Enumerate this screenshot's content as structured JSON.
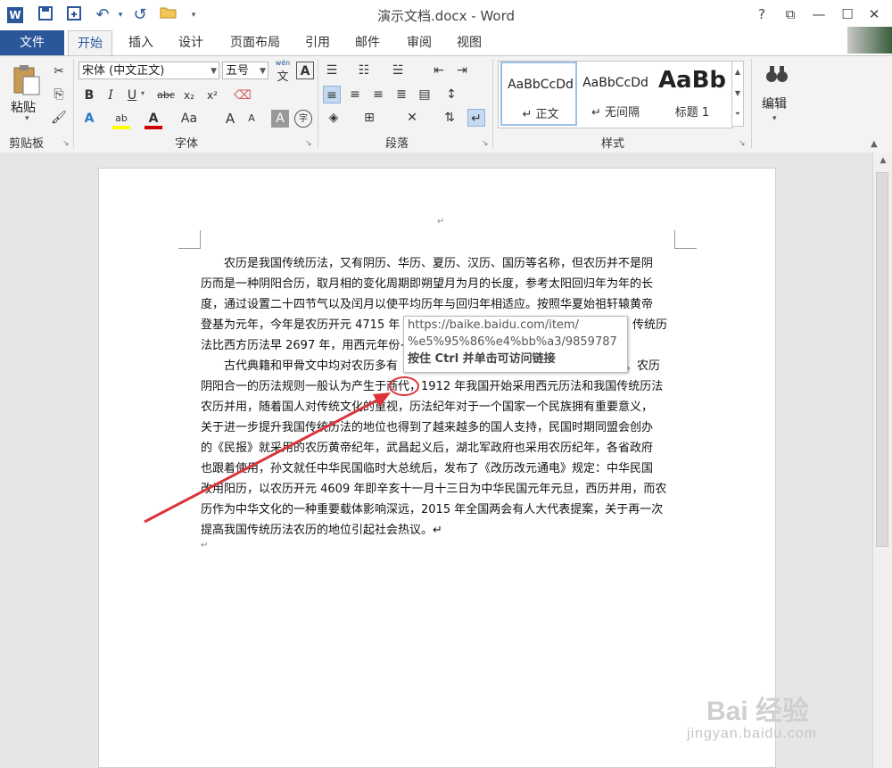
{
  "window": {
    "title": "演示文档.docx - Word",
    "help": "?",
    "restore_ribbon": "⧉",
    "minimize": "—",
    "maximize": "☐",
    "close": "✕"
  },
  "qat": {
    "word_icon": "W",
    "save": "💾",
    "undo": "↶",
    "redo": "↺",
    "open": "📂",
    "more": "▾"
  },
  "tabs": [
    "文件",
    "开始",
    "插入",
    "设计",
    "页面布局",
    "引用",
    "邮件",
    "审阅",
    "视图"
  ],
  "ribbon": {
    "clipboard": {
      "paste_label": "粘贴",
      "group_label": "剪贴板"
    },
    "font": {
      "font_name": "宋体 (中文正文)",
      "font_size": "五号",
      "phonetic": "wén",
      "phonetic_char": "文",
      "char_border": "A",
      "bold": "B",
      "italic": "I",
      "underline": "U",
      "strike": "abc",
      "subscript": "x₂",
      "superscript": "x²",
      "text_effects": "A",
      "highlight": "ab",
      "font_color": "A",
      "change_case": "Aa",
      "grow": "A",
      "shrink": "A",
      "shading": "A",
      "enclose": "字",
      "group_label": "字体",
      "highlight_color": "#ffff00",
      "font_color_value": "#d00000"
    },
    "paragraph": {
      "group_label": "段落"
    },
    "styles": {
      "items": [
        {
          "preview": "AaBbCcDd",
          "name": "↵ 正文"
        },
        {
          "preview": "AaBbCcDd",
          "name": "↵ 无间隔"
        },
        {
          "preview": "AaBb",
          "name": "标题 1"
        }
      ],
      "group_label": "样式"
    },
    "editing": {
      "label": "编辑",
      "icon": "binoculars-icon"
    }
  },
  "document": {
    "top_mark": "↵",
    "para1_lines": [
      "　　农历是我国传统历法，又有阴历、华历、夏历、汉历、国历等名称，但农历并不是阴",
      "历而是一种阴阳合历，取月相的变化周期即朔望月为月的长度，参考太阳回归年为年的长",
      "度，通过设置二十四节气以及闰月以使平均历年与回归年相适应。按照华夏始祖轩辕黄帝",
      "登基为元年，今年是农历开元 4715 年",
      "法比西方历法早 2697 年，用西元年份+"
    ],
    "para1_line4_tail": "传统历",
    "para2_lines": [
      "　　古代典籍和甲骨文中均对农历多有",
      "阴阳合一的历法规则一般认为产生于",
      "农历并用，随着国人对传统文化的重视，历法纪年对于一个国家一个民族拥有重要意义，",
      "关于进一步提升我国传统历法的地位也得到了越来越多的国人支持，民国时期同盟会创办",
      "的《民报》就采用的农历黄帝纪年，武昌起义后，湖北军政府也采用农历纪年，各省政府",
      "也跟着使用，孙文就任中华民国临时大总统后，发布了《改历改元通电》规定：中华民国",
      "改用阳历，以农历开元 4609 年即辛亥十一月十三日为中华民国元年元旦，西历并用，而农",
      "历作为中华文化的一种重要载体影响深远，2015 年全国两会有人大代表提案，关于再一次",
      "提高我国传统历法农历的地位引起社会热议。↵"
    ],
    "para2_line1_tail": "。农历",
    "hyperlink_text": "商代",
    "para2_line2_tail": "，1912 年我国开始采用西元历法和我国传统历法",
    "empty_mark": "↵"
  },
  "tooltip": {
    "url_line1": "https://baike.baidu.com/item/",
    "url_line2": "%e5%95%86%e4%bb%a3/9859787",
    "hint": "按住 Ctrl 并单击可访问链接"
  },
  "watermark": {
    "brand": "Bai 经验",
    "url": "jingyan.baidu.com"
  },
  "annotation": {
    "arrow_color": "#d9353a"
  }
}
